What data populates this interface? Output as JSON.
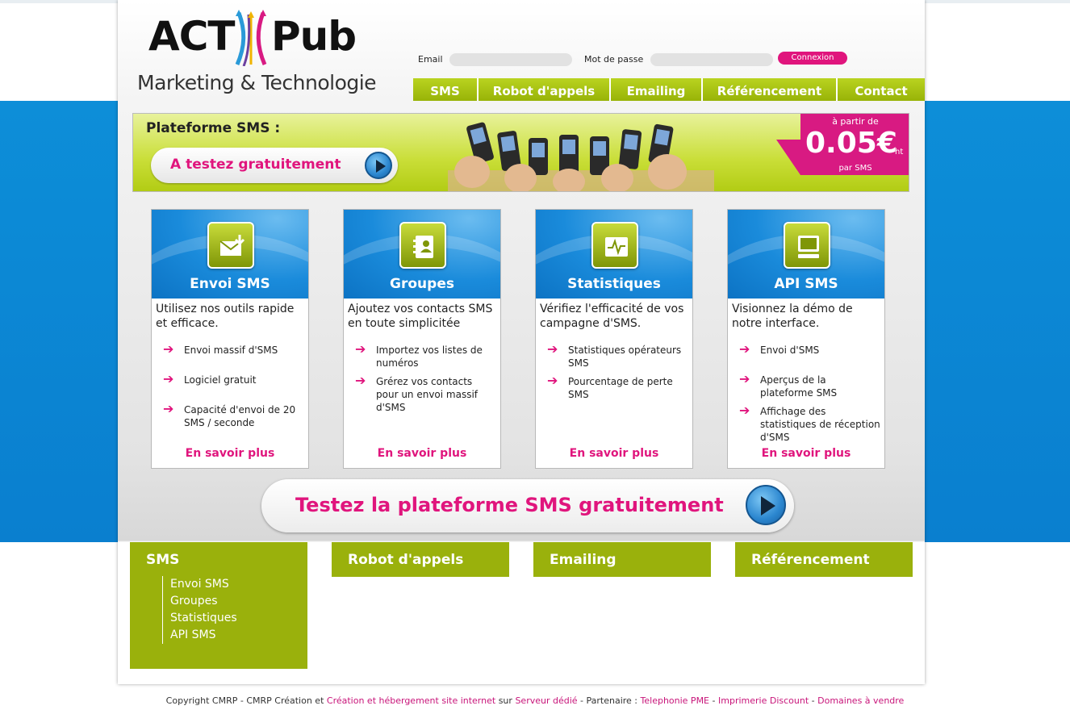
{
  "logo": {
    "act": "ACT",
    "pub": "Pub",
    "tagline": "Marketing & Technologie"
  },
  "login": {
    "email_label": "Email",
    "password_label": "Mot de passe",
    "email_value": "",
    "password_value": "",
    "button": "Connexion"
  },
  "nav": [
    {
      "label": "SMS"
    },
    {
      "label": "Robot d'appels"
    },
    {
      "label": "Emailing"
    },
    {
      "label": "Référencement"
    },
    {
      "label": "Contact"
    }
  ],
  "banner": {
    "title": "Plateforme SMS :",
    "button": "A testez gratuitement",
    "price_from": "à partir de",
    "price": "0.05€",
    "price_ht": "ht",
    "price_per": "par SMS"
  },
  "cards": [
    {
      "title": "Envoi SMS",
      "icon": "envelope-icon",
      "intro": "Utilisez nos outils rapide et efficace.",
      "bullets": [
        "Envoi massif d'SMS",
        "Logiciel gratuit",
        "Capacité d'envoi de 20 SMS / seconde"
      ],
      "more": "En savoir plus"
    },
    {
      "title": "Groupes",
      "icon": "contacts-icon",
      "intro": "Ajoutez vos contacts SMS en toute simplicitée",
      "bullets": [
        "Importez vos listes de numéros",
        "Grérez vos contacts pour un envoi massif d'SMS"
      ],
      "more": "En savoir plus"
    },
    {
      "title": "Statistiques",
      "icon": "chart-icon",
      "intro": "Vérifiez l'efficacité de vos campagne d'SMS.",
      "bullets": [
        "Statistiques opérateurs SMS",
        "Pourcentage de perte SMS"
      ],
      "more": "En savoir plus"
    },
    {
      "title": "API SMS",
      "icon": "monitor-icon",
      "intro": "Visionnez la démo de notre interface.",
      "bullets": [
        "Envoi d'SMS",
        "Aperçus de la plateforme SMS",
        "Affichage des statistiques de réception d'SMS"
      ],
      "more": "En savoir plus"
    }
  ],
  "cta": {
    "label": "Testez la plateforme SMS gratuitement"
  },
  "footer_boxes": [
    {
      "title": "SMS",
      "items": [
        "Envoi SMS",
        "Groupes",
        "Statistiques",
        "API SMS"
      ]
    },
    {
      "title": "Robot d'appels"
    },
    {
      "title": "Emailing"
    },
    {
      "title": "Référencement"
    }
  ],
  "copyright": {
    "prefix": "Copyright CMRP - CMRP Création et",
    "link1": "Création et hébergement site internet",
    "sur": "sur",
    "link2": "Serveur dédié",
    "partner": "- Partenaire :",
    "link3": "Telephonie PME",
    "sep1": "-",
    "link4": "Imprimerie Discount",
    "sep2": "-",
    "link5": "Domaines à vendre"
  },
  "colors": {
    "brand_pink": "#e0157d",
    "brand_green": "#a6c20e",
    "brand_blue": "#0d8ed8"
  }
}
